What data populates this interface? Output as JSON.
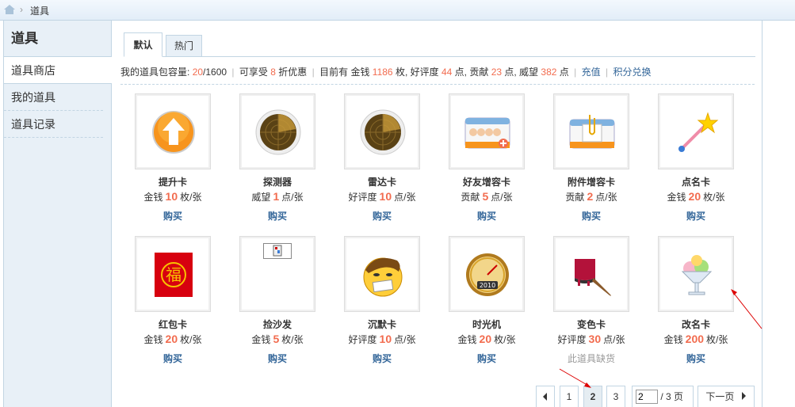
{
  "breadcrumb": {
    "current": "道具"
  },
  "sidebar": {
    "title": "道具",
    "items": [
      {
        "label": "道具商店"
      },
      {
        "label": "我的道具"
      },
      {
        "label": "道具记录"
      }
    ]
  },
  "tabs": [
    {
      "label": "默认"
    },
    {
      "label": "热门"
    }
  ],
  "info": {
    "capacity_label": "我的道具包容量:",
    "capacity_used": "20",
    "capacity_total": "/1600",
    "discount_pre": "可享受",
    "discount_value": "8",
    "discount_post": "折优惠",
    "current_pre": "目前有 金钱",
    "money": "1186",
    "money_unit": "枚, 好评度",
    "reputation": "44",
    "reputation_unit": "点, 贡献",
    "contribution": "23",
    "contribution_unit": "点, 威望",
    "prestige": "382",
    "prestige_unit": "点",
    "recharge_link": "充值",
    "exchange_link": "积分兑换"
  },
  "items": [
    {
      "name": "提升卡",
      "currency": "金钱",
      "price": "10",
      "unit": "枚/张",
      "action": "购买"
    },
    {
      "name": "探测器",
      "currency": "威望",
      "price": "1",
      "unit": "点/张",
      "action": "购买"
    },
    {
      "name": "雷达卡",
      "currency": "好评度",
      "price": "10",
      "unit": "点/张",
      "action": "购买"
    },
    {
      "name": "好友增容卡",
      "currency": "贡献",
      "price": "5",
      "unit": "点/张",
      "action": "购买"
    },
    {
      "name": "附件增容卡",
      "currency": "贡献",
      "price": "2",
      "unit": "点/张",
      "action": "购买"
    },
    {
      "name": "点名卡",
      "currency": "金钱",
      "price": "20",
      "unit": "枚/张",
      "action": "购买"
    },
    {
      "name": "红包卡",
      "currency": "金钱",
      "price": "20",
      "unit": "枚/张",
      "action": "购买"
    },
    {
      "name": "捡沙发",
      "currency": "金钱",
      "price": "5",
      "unit": "枚/张",
      "action": "购买"
    },
    {
      "name": "沉默卡",
      "currency": "好评度",
      "price": "10",
      "unit": "点/张",
      "action": "购买"
    },
    {
      "name": "时光机",
      "currency": "金钱",
      "price": "20",
      "unit": "枚/张",
      "action": "购买"
    },
    {
      "name": "变色卡",
      "currency": "好评度",
      "price": "30",
      "unit": "点/张",
      "action": "此道具缺货"
    },
    {
      "name": "改名卡",
      "currency": "金钱",
      "price": "200",
      "unit": "枚/张",
      "action": "购买"
    }
  ],
  "pager": {
    "pages": [
      "1",
      "2",
      "3"
    ],
    "current": "2",
    "input_value": "2",
    "total": "/ 3 页",
    "next": "下一页"
  },
  "icon_text": {
    "hongbao": "福",
    "clock_year": "2010"
  },
  "colors": {
    "accent_number": "#f26c4f",
    "link": "#336699",
    "border": "#c2d5e3",
    "sidebar_bg": "#e8f0f7"
  }
}
